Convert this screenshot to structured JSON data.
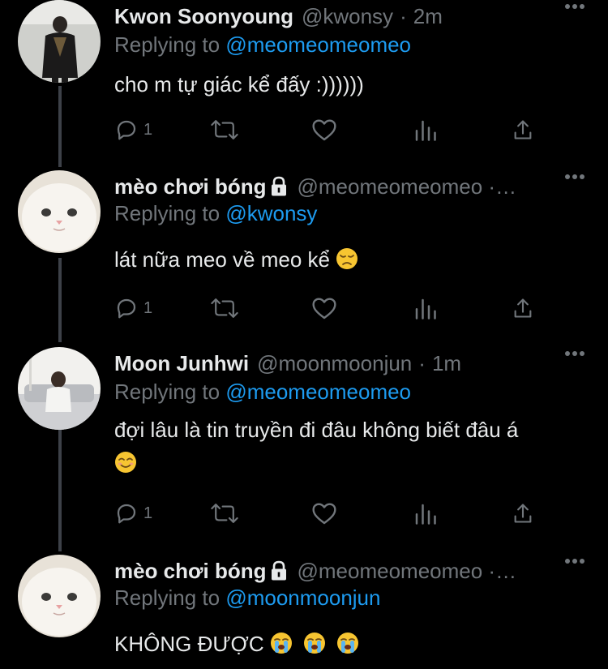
{
  "tweets": [
    {
      "name": "Kwon Soonyoung",
      "handle": "@kwonsy",
      "dot": "·",
      "time": "2m",
      "replying_prefix": "Replying to",
      "replying_to": "@meomeomeomeo",
      "text": "cho m tự giác kể đấy :))))))",
      "reply_count": "1",
      "locked": false
    },
    {
      "name": "mèo chơi bóng",
      "handle": "@meomeomeomeo ·…",
      "dot": "",
      "time": "",
      "replying_prefix": "Replying to",
      "replying_to": "@kwonsy",
      "text": "lát nữa meo về meo kể",
      "reply_count": "1",
      "locked": true
    },
    {
      "name": "Moon Junhwi",
      "handle": "@moonmoonjun",
      "dot": "·",
      "time": "1m",
      "replying_prefix": "Replying to",
      "replying_to": "@meomeomeomeo",
      "text": "đợi lâu là tin truyền đi đâu không biết đâu á",
      "reply_count": "1",
      "locked": false
    },
    {
      "name": "mèo chơi bóng",
      "handle": "@meomeomeomeo ·…",
      "dot": "",
      "time": "",
      "replying_prefix": "Replying to",
      "replying_to": "@moonmoonjun",
      "text": "KHÔNG ĐƯỢC",
      "reply_count": "",
      "locked": true
    }
  ],
  "icons": [
    "reply-icon",
    "retweet-icon",
    "like-icon",
    "analytics-icon",
    "share-icon",
    "more-icon",
    "lock-icon"
  ],
  "colors": {
    "background": "#000000",
    "text": "#e7e9ea",
    "muted": "#71767b",
    "link": "#1d9bf0"
  }
}
